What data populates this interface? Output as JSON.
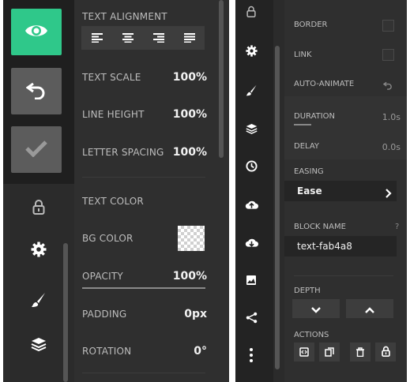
{
  "left": {
    "text_alignment": {
      "label": "TEXT ALIGNMENT"
    },
    "text_scale": {
      "label": "TEXT SCALE",
      "value": "100%"
    },
    "line_height": {
      "label": "LINE HEIGHT",
      "value": "100%"
    },
    "letter_spacing": {
      "label": "LETTER SPACING",
      "value": "100%"
    },
    "text_color": {
      "label": "TEXT COLOR"
    },
    "bg_color": {
      "label": "BG COLOR"
    },
    "opacity": {
      "label": "OPACITY",
      "value": "100%"
    },
    "padding": {
      "label": "PADDING",
      "value": "0px"
    },
    "rotation": {
      "label": "ROTATION",
      "value": "0°"
    }
  },
  "right": {
    "border": {
      "label": "BORDER"
    },
    "link": {
      "label": "LINK"
    },
    "auto_animate": {
      "label": "AUTO-ANIMATE"
    },
    "duration": {
      "label": "DURATION",
      "value": "1.0s"
    },
    "delay": {
      "label": "DELAY",
      "value": "0.0s"
    },
    "easing": {
      "label": "EASING",
      "value": "Ease"
    },
    "block_name": {
      "label": "BLOCK NAME",
      "help": "?",
      "value": "text-fab4a8"
    },
    "depth": {
      "label": "DEPTH"
    },
    "actions": {
      "label": "ACTIONS"
    }
  },
  "colors": {
    "accent": "#2fc88a",
    "panel": "#2b2b2b"
  },
  "icons": {
    "left_rail": [
      "eye-icon",
      "undo-icon",
      "check-icon",
      "lock-icon",
      "gear-icon",
      "brush-icon",
      "layers-icon"
    ],
    "right_rail": [
      "lock-icon",
      "gear-icon",
      "brush-icon",
      "layers-icon",
      "clock-icon",
      "cloud-upload-icon",
      "cloud-download-icon",
      "image-icon",
      "share-icon",
      "more-vertical-icon"
    ]
  }
}
